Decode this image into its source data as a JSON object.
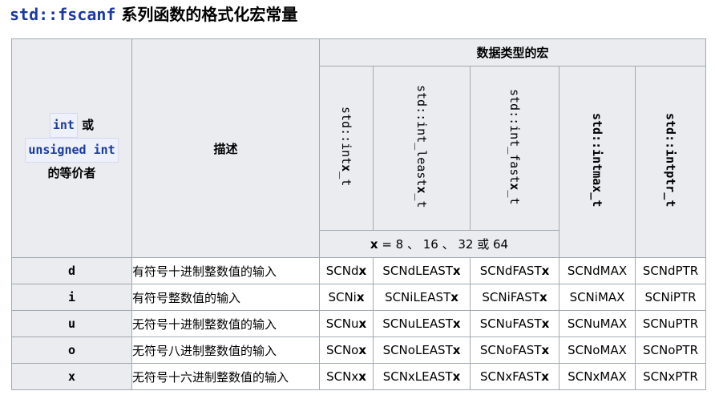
{
  "title": {
    "code": "std::fscanf",
    "text": " 系列函数的格式化宏常量"
  },
  "header": {
    "int_label": "int",
    "or_label": " 或",
    "unsigned_label": "unsigned int",
    "equiv_label": "的等价者",
    "desc_label": "描述",
    "group_label": "数据类型的宏",
    "types": [
      {
        "pre": "std::int",
        "x": "x",
        "post": "_t"
      },
      {
        "pre": "std::int_least",
        "x": "x",
        "post": "_t"
      },
      {
        "pre": "std::int_fast",
        "x": "x",
        "post": "_t"
      },
      {
        "pre": "std::intmax_t",
        "x": "",
        "post": ""
      },
      {
        "pre": "std::intptr_t",
        "x": "",
        "post": ""
      }
    ],
    "x_note": {
      "x": "x",
      "rest": " = 8 、 16 、 32 或 64"
    }
  },
  "rows": [
    {
      "spec": "d",
      "desc": "有符号十进制整数值的输入",
      "c1": "SCNd",
      "c2": "SCNdLEAST",
      "c3": "SCNdFAST",
      "c4": "SCNdMAX",
      "c5": "SCNdPTR"
    },
    {
      "spec": "i",
      "desc": "有符号整数值的输入",
      "c1": "SCNi",
      "c2": "SCNiLEAST",
      "c3": "SCNiFAST",
      "c4": "SCNiMAX",
      "c5": "SCNiPTR"
    },
    {
      "spec": "u",
      "desc": "无符号十进制整数值的输入",
      "c1": "SCNu",
      "c2": "SCNuLEAST",
      "c3": "SCNuFAST",
      "c4": "SCNuMAX",
      "c5": "SCNuPTR"
    },
    {
      "spec": "o",
      "desc": "无符号八进制整数值的输入",
      "c1": "SCNo",
      "c2": "SCNoLEAST",
      "c3": "SCNoFAST",
      "c4": "SCNoMAX",
      "c5": "SCNoPTR"
    },
    {
      "spec": "x",
      "desc": "无符号十六进制整数值的输入",
      "c1": "SCNx",
      "c2": "SCNxLEAST",
      "c3": "SCNxFAST",
      "c4": "SCNxMAX",
      "c5": "SCNxPTR"
    }
  ],
  "suffix_x": "x"
}
